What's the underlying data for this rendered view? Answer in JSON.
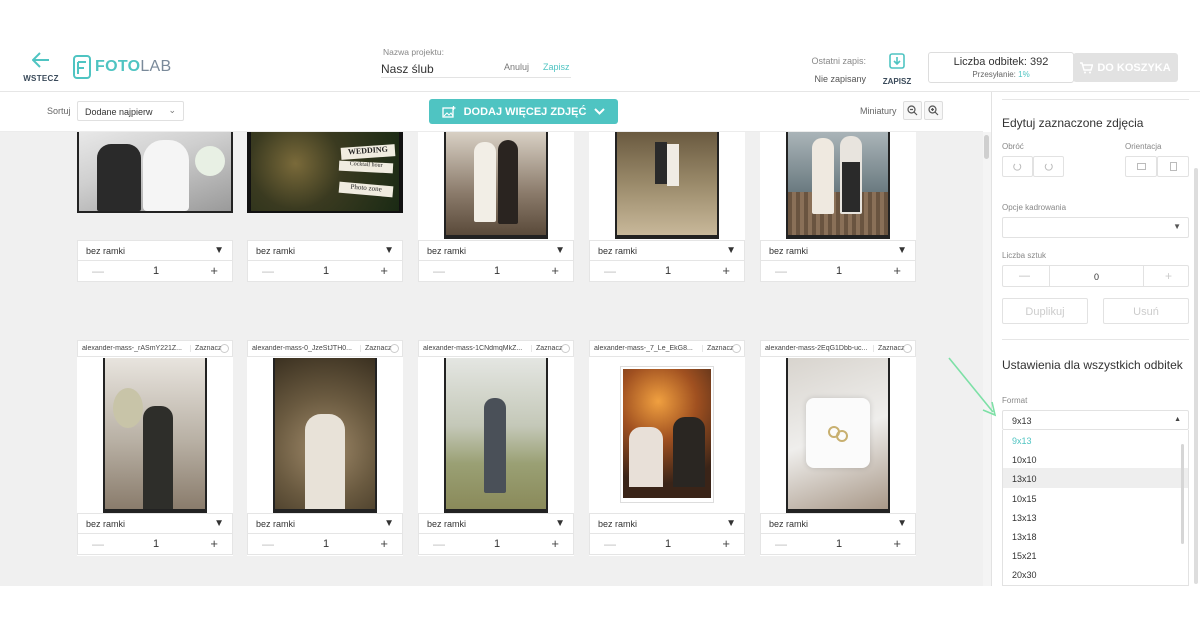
{
  "header": {
    "back_label": "WSTECZ",
    "logo": {
      "part1": "FOTO",
      "part2": "LAB"
    },
    "project_label": "Nazwa projektu:",
    "project_name": "Nasz ślub",
    "cancel_label": "Anuluj",
    "save_link_label": "Zapisz",
    "last_save_label": "Ostatni zapis:",
    "last_save_value": "Nie zapisany",
    "save_button_label": "ZAPISZ",
    "prints_count_label": "Liczba odbitek: 392",
    "upload_label": "Przesyłanie:",
    "upload_value": "1%",
    "cart_button_label": "DO KOSZYKA"
  },
  "toolbar": {
    "sort_label": "Sortuj",
    "sort_value": "Dodane najpierw",
    "add_photos_label": "DODAJ WIĘCEJ ZDJĘĆ",
    "thumbnails_label": "Miniatury"
  },
  "gallery": {
    "row1": [
      {
        "frame": "bez ramki",
        "qty": "1"
      },
      {
        "frame": "bez ramki",
        "qty": "1"
      },
      {
        "frame": "bez ramki",
        "qty": "1"
      },
      {
        "frame": "bez ramki",
        "qty": "1"
      },
      {
        "frame": "bez ramki",
        "qty": "1"
      }
    ],
    "row2": [
      {
        "filename": "alexander-mass-_rASmY221Z...",
        "select": "Zaznacz",
        "frame": "bez ramki",
        "qty": "1"
      },
      {
        "filename": "alexander-mass-0_JzeStJTH0...",
        "select": "Zaznacz",
        "frame": "bez ramki",
        "qty": "1"
      },
      {
        "filename": "alexander-mass-1CNdmqMkZ...",
        "select": "Zaznacz",
        "frame": "bez ramki",
        "qty": "1"
      },
      {
        "filename": "alexander-mass-_7_Le_EkG8...",
        "select": "Zaznacz",
        "frame": "bez ramki",
        "qty": "1"
      },
      {
        "filename": "alexander-mass-2EqG1Dbb-uc...",
        "select": "Zaznacz",
        "frame": "bez ramki",
        "qty": "1"
      }
    ],
    "sign_wedding": "WEDDING",
    "sign_cocktail": "Cocktail hour",
    "sign_photo": "Photo zone"
  },
  "right_panel": {
    "edit_title": "Edytuj zaznaczone zdjęcia",
    "rotate_label": "Obróć",
    "orientation_label": "Orientacja",
    "crop_label": "Opcje kadrowania",
    "count_label": "Liczba sztuk",
    "count_value": "0",
    "duplicate_label": "Duplikuj",
    "delete_label": "Usuń",
    "all_title": "Ustawienia dla wszystkich odbitek",
    "format_label": "Format",
    "format_value": "9x13",
    "format_options": [
      "9x13",
      "10x10",
      "13x10",
      "10x15",
      "13x13",
      "13x18",
      "15x21",
      "20x30"
    ]
  },
  "colors": {
    "accent": "#4fc4c2",
    "arrow": "#7de0a6"
  }
}
